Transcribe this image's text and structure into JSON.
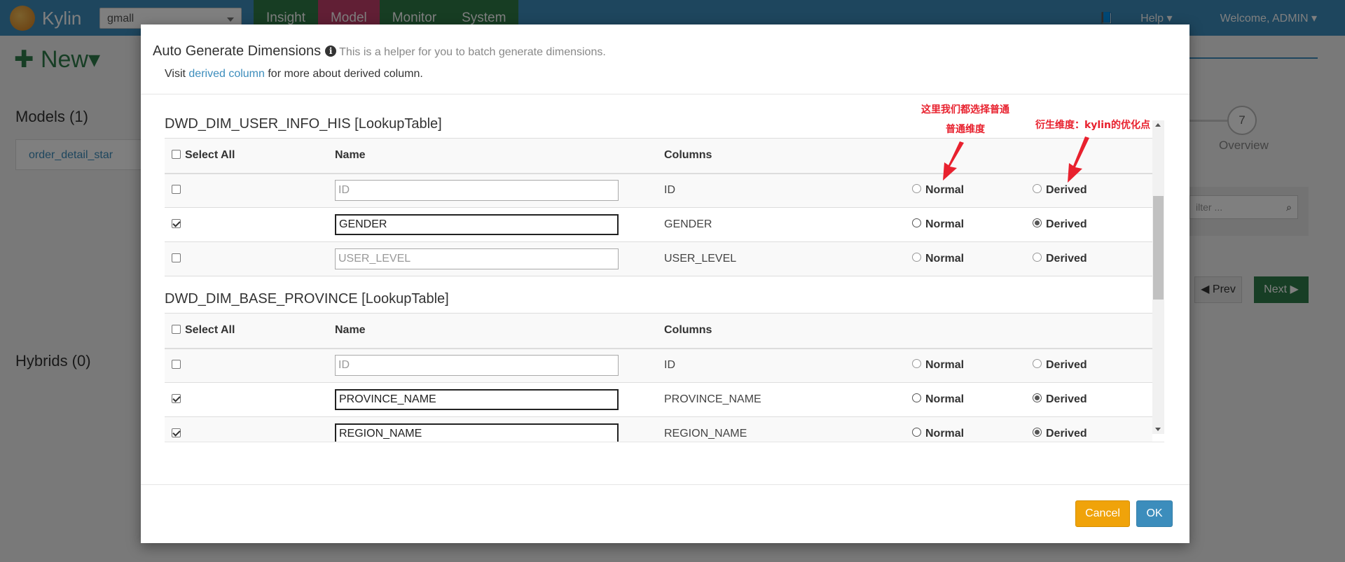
{
  "navbar": {
    "brand": "Kylin",
    "project": "gmall",
    "tabs": [
      {
        "label": "Insight"
      },
      {
        "label": "Model"
      },
      {
        "label": "Monitor"
      },
      {
        "label": "System"
      }
    ],
    "help": "Help",
    "welcome": "Welcome, ADMIN"
  },
  "page": {
    "new_label": "New",
    "models_heading": "Models (1)",
    "model_item": "order_detail_star",
    "hybrids_heading": "Hybrids (0)",
    "step_number": "7",
    "step_label": "Overview",
    "filter_placeholder": "ilter ...",
    "prev_label": "Prev",
    "next_label": "Next"
  },
  "modal": {
    "title": "Auto Generate Dimensions",
    "subtitle": "This is a helper for you to batch generate dimensions.",
    "visit_prefix": "Visit",
    "visit_link": "derived column",
    "visit_suffix": "for more about derived column.",
    "headers": {
      "select_all": "Select All",
      "name": "Name",
      "columns": "Columns"
    },
    "normal_label": "Normal",
    "derived_label": "Derived",
    "tables": [
      {
        "title": "DWD_DIM_USER_INFO_HIS [LookupTable]",
        "rows": [
          {
            "checked": false,
            "name": "ID",
            "column": "ID",
            "choice": "none"
          },
          {
            "checked": true,
            "name": "GENDER",
            "column": "GENDER",
            "choice": "derived"
          },
          {
            "checked": false,
            "name": "USER_LEVEL",
            "column": "USER_LEVEL",
            "choice": "none"
          }
        ]
      },
      {
        "title": "DWD_DIM_BASE_PROVINCE [LookupTable]",
        "rows": [
          {
            "checked": false,
            "name": "ID",
            "column": "ID",
            "choice": "none"
          },
          {
            "checked": true,
            "name": "PROVINCE_NAME",
            "column": "PROVINCE_NAME",
            "choice": "derived"
          },
          {
            "checked": true,
            "name": "REGION_NAME",
            "column": "REGION_NAME",
            "choice": "derived"
          }
        ]
      }
    ],
    "cancel_label": "Cancel",
    "ok_label": "OK"
  },
  "annotations": {
    "note1_line1": "这里我们都选择普通",
    "note1_line2": "普通维度",
    "note2": "衍生维度：kylin的优化点"
  },
  "colors": {
    "navbar": "#3c8dbc",
    "annotation": "#e8212e",
    "cancel": "#f0a30a",
    "ok": "#3c8dbc"
  }
}
